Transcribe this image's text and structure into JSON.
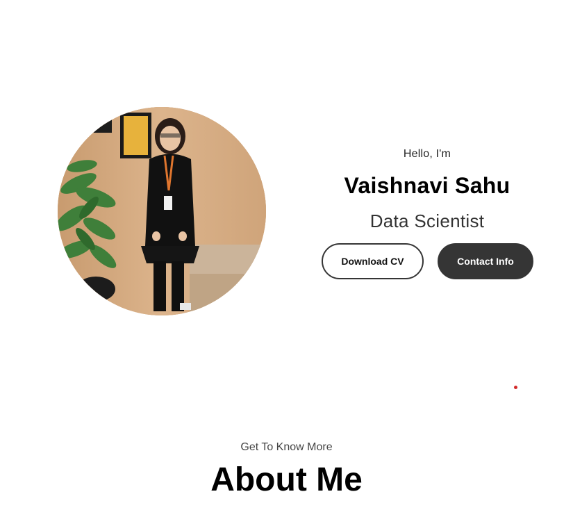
{
  "hero": {
    "greeting": "Hello, I'm",
    "name": "Vaishnavi Sahu",
    "role": "Data Scientist",
    "profile_alt": "Vaishnavi Sahu profile picture"
  },
  "buttons": {
    "download_cv": "Download CV",
    "contact_info": "Contact Info"
  },
  "about": {
    "subtitle": "Get To Know More",
    "title": "About Me"
  },
  "colors": {
    "button_dark": "#353535",
    "text_dark": "#000000",
    "dot_red": "#d22a2a"
  }
}
